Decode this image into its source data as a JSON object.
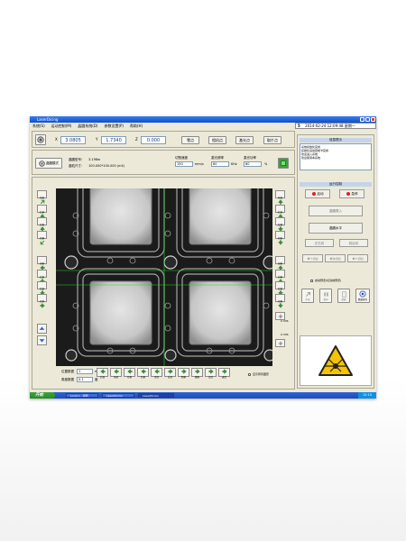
{
  "window": {
    "title": "LaserDicing"
  },
  "menu": [
    "系统(S)",
    "运动控制(M)",
    "晶圆系统(D)",
    "参数设置(P)",
    "帮助(H)"
  ],
  "status": {
    "number": "5",
    "datetime": "2014-02-24 12:09:48 星期一"
  },
  "coords": {
    "x_label": "X",
    "x_value": "3.0805",
    "y_label": "Y",
    "y_value": "1.7340",
    "z_label": "Z",
    "z_value": "0.000"
  },
  "top_buttons": [
    "零点",
    "相机点",
    "激光点",
    "取片点"
  ],
  "wafer": {
    "button": "晶圆模式",
    "model_label": "晶圆型号:",
    "model_value": "3-198w",
    "size_label": "晶粒尺寸:",
    "size_value": "100.000*100.000 (mil)"
  },
  "cut_params": {
    "speed_label": "切割速度",
    "speed_value": "150",
    "speed_unit": "mm/s",
    "freq_label": "激光频率",
    "freq_value": "80",
    "freq_unit": "KHz",
    "power_label": "激光功率",
    "power_value": "80",
    "power_unit": "%"
  },
  "left_controls": [
    "前进",
    "后退",
    "左移",
    "右移",
    "前移",
    "后移",
    "左移",
    "右移"
  ],
  "right_controls": [
    "前进",
    "后退",
    "左移",
    "右移",
    "前移",
    "后移",
    "左移",
    "右移"
  ],
  "right_values": {
    "upper": "0.336",
    "lower": "0.336"
  },
  "bottom_fields": {
    "pos_label": "位置数据",
    "pos_value": "1",
    "pos_unit": "mm",
    "step_label": "角度数据",
    "step_value": "0.1",
    "step_unit": "度"
  },
  "bottom_buttons": [
    "后退",
    "前进",
    "左移",
    "右移",
    "正转",
    "反转",
    "粗移",
    "细移",
    "定位",
    "返回"
  ],
  "bottom_check_label": "显示所有图形",
  "info_panel": {
    "title": "信息提示",
    "lines": [
      "系统初始化完成",
      "初始化运动控制卡完成",
      "欢迎进入系统",
      "欢迎使用本系统"
    ]
  },
  "run_panel": {
    "title": "运行控制",
    "btn_start": "启动",
    "btn_stop": "急停",
    "btn_load": "晶圆载入",
    "btn_level": "晶圆水平",
    "btn_row": [
      "左右切",
      "前后切"
    ],
    "btn_row2": [
      "单个切割",
      "单次切割",
      "单个切割"
    ],
    "check_label": "启动预览(切割前预览)",
    "icons": [
      "手动",
      "暂停",
      "数据",
      "数据保存"
    ]
  },
  "taskbar": {
    "start": "开始",
    "tasks": [
      "Local 1 - 画图",
      "LaserDicing",
      "LaserDicing"
    ],
    "clock": "12:10"
  }
}
